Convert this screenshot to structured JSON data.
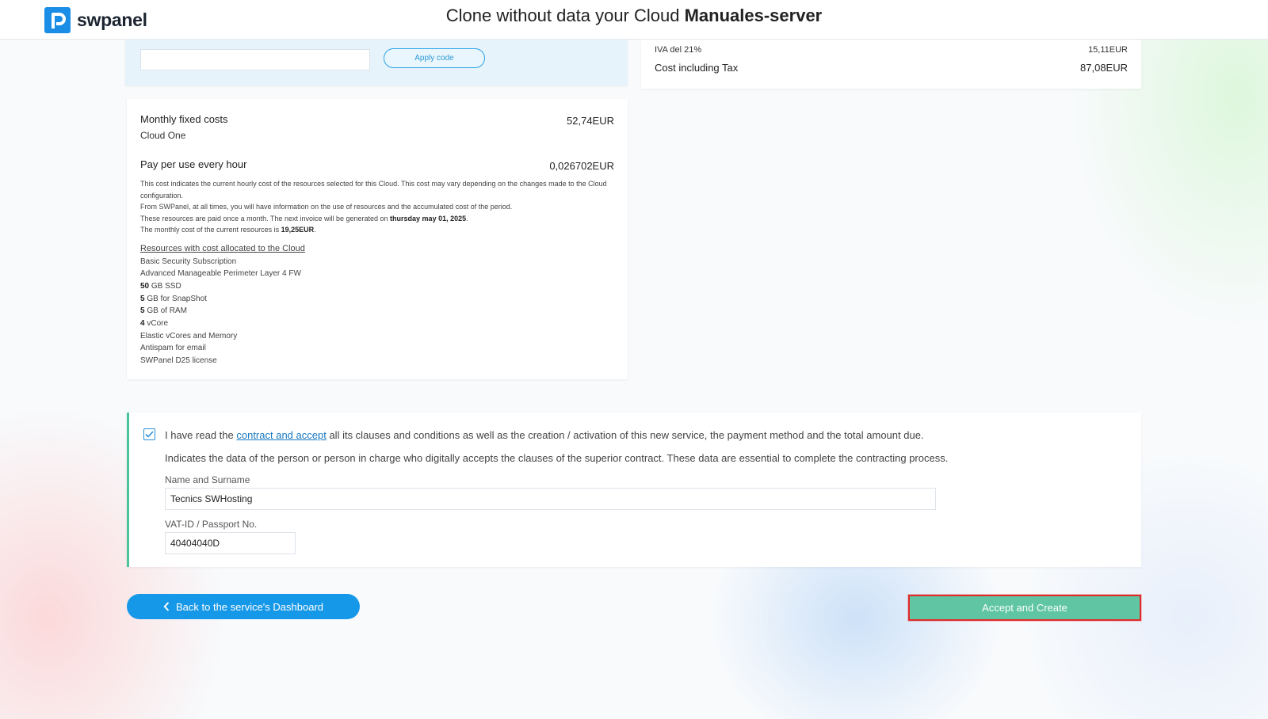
{
  "header": {
    "brand": "swpanel",
    "title_prefix": "Clone without data your Cloud",
    "title_server": "Manuales-server"
  },
  "promo": {
    "code_value": "",
    "apply_label": "Apply code"
  },
  "tax": {
    "iva_label": "IVA del 21%",
    "iva_value": "15,11EUR",
    "total_label": "Cost including Tax",
    "total_value": "87,08EUR"
  },
  "costs": {
    "monthly_label": "Monthly fixed costs",
    "monthly_value": "52,74EUR",
    "monthly_plan": "Cloud One",
    "hourly_label": "Pay per use every hour",
    "hourly_value": "0,026702EUR",
    "desc_line1": "This cost indicates the current hourly cost of the resources selected for this Cloud. This cost may vary depending on the changes made to the Cloud configuration.",
    "desc_line2": "From SWPanel, at all times, you will have information on the use of resources and the accumulated cost of the period.",
    "desc_line3_prefix": "These resources are paid once a month. The next invoice will be generated on",
    "desc_line3_date": "thursday may 01, 2025",
    "desc_line3_suffix": ".",
    "desc_line4_prefix": "The monthly cost of the current resources is",
    "desc_line4_value": "19,25EUR",
    "desc_line4_suffix": ".",
    "resources_title": "Resources with cost allocated to the Cloud",
    "resources": [
      {
        "qty": "",
        "text": "Basic Security Subscription"
      },
      {
        "qty": "",
        "text": "Advanced Manageable Perimeter Layer 4 FW"
      },
      {
        "qty": "50",
        "text": "GB SSD"
      },
      {
        "qty": "5",
        "text": "GB for SnapShot"
      },
      {
        "qty": "5",
        "text": "GB of RAM"
      },
      {
        "qty": "4",
        "text": "vCore"
      },
      {
        "qty": "",
        "text": "Elastic vCores and Memory"
      },
      {
        "qty": "",
        "text": "Antispam for email"
      },
      {
        "qty": "",
        "text": "SWPanel D25 license"
      }
    ]
  },
  "contract": {
    "checked": true,
    "text_prefix": "I have read the",
    "link_label": "contract and accept",
    "text_suffix": "all its clauses and conditions as well as the creation / activation of this new service, the payment method and the total amount due.",
    "indication": "Indicates the data of the person or person in charge who digitally accepts the clauses of the superior contract. These data are essential to complete the contracting process.",
    "name_label": "Name and Surname",
    "name_value": "Tecnics SWHosting",
    "vat_label": "VAT-ID / Passport No.",
    "vat_value": "40404040D"
  },
  "actions": {
    "back_label": "Back to the service's Dashboard",
    "accept_label": "Accept and Create"
  },
  "colors": {
    "brand_blue": "#1698e8",
    "accept_green": "#5fc5a3",
    "highlight_red": "#e02b2b",
    "contract_border": "#4cc49a"
  }
}
